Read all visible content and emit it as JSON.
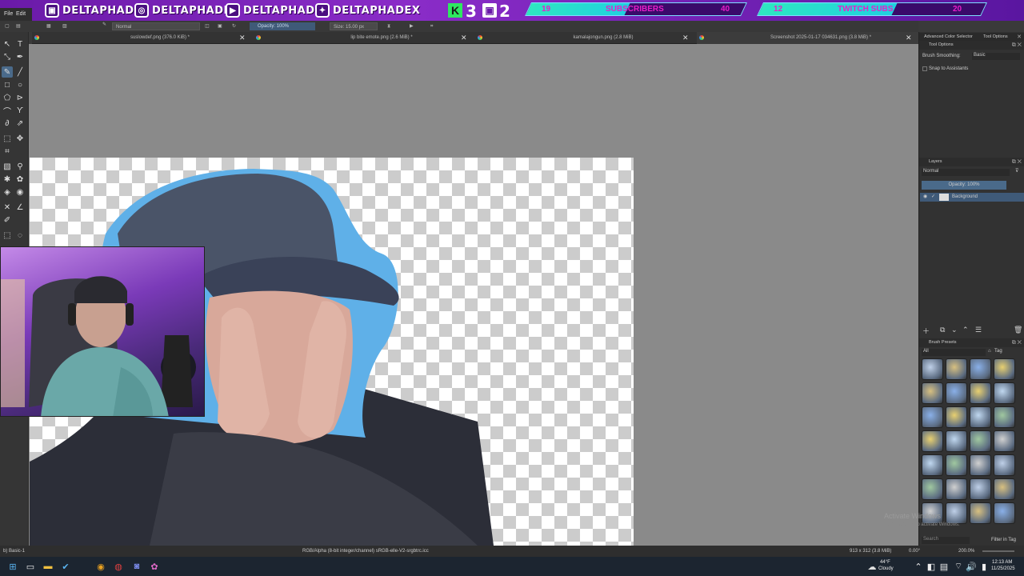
{
  "banner": {
    "handles": [
      "DELTAPHADE",
      "DELTAPHADE",
      "DELTAPHADE",
      "DELTAPHADEX"
    ],
    "kick_count": "3",
    "twitch_count": "2",
    "subscribers_goal": {
      "current": "19",
      "label": "SUBSCRIBERS",
      "target": "40",
      "progress": 0.46
    },
    "twitch_subs_goal": {
      "current": "12",
      "label": "TWITCH SUBS",
      "target": "20",
      "progress": 0.6
    }
  },
  "menu": {
    "file": "File",
    "edit": "Edit"
  },
  "toolbar": {
    "blend_mode": "Normal",
    "opacity": "Opacity: 100%",
    "size": "Size: 15.00 px"
  },
  "tabs": [
    {
      "title": "suslowdef.png (376.0 KiB) *"
    },
    {
      "title": "lip bite emote.png (2.6 MiB) *"
    },
    {
      "title": "kamalajongun.png (2.8 MiB)"
    },
    {
      "title": "Screenshot 2025-01-17 034631.png (3.8 MiB) *"
    }
  ],
  "docker": {
    "tabs": [
      "Advanced Color Selector",
      "Tool Options"
    ],
    "tool_options_title": "Tool Options",
    "brush_smoothing_label": "Brush Smoothing:",
    "brush_smoothing_value": "Basic",
    "snap_label": "Snap to Assistants",
    "layers_title": "Layers",
    "layer_blend": "Normal",
    "layer_opacity": "Opacity: 100%",
    "layer_name": "Background",
    "brush_presets_title": "Brush Presets",
    "brush_filter": "All",
    "tag_label": "Tag",
    "search_placeholder": "Search",
    "filter_in_tag": "Filter in Tag",
    "watermark_line1": "Activate Windows",
    "watermark_line2": "Go to Settings to activate Windows."
  },
  "status": {
    "brush": "b) Basic-1",
    "color_info": "RGB/Alpha (8-bit integer/channel)  sRGB-elle-V2-srgbtrc.icc",
    "dimensions": "913 x 312 (3.8 MiB)",
    "rotation": "0.00°",
    "zoom": "200.0%"
  },
  "taskbar": {
    "weather_temp": "44°F",
    "weather_desc": "Cloudy",
    "time": "12:13 AM",
    "date": "11/25/2025"
  },
  "colors": {
    "accent": "#8a2cc8",
    "goal_fill": "#2ee8c0",
    "layer_selected": "#3f5a78"
  }
}
